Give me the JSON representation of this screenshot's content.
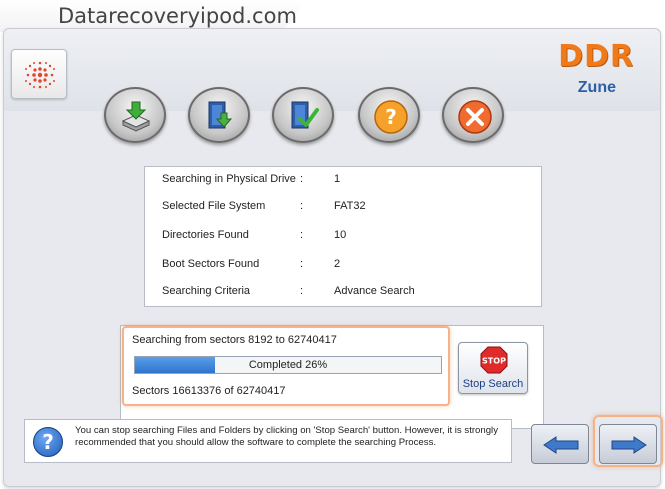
{
  "watermark": {
    "site": "Datarecoveryipod.com"
  },
  "header": {
    "brand": "DDR",
    "product": "Zune",
    "toolbar": [
      {
        "name": "recover-drive",
        "icon": "drive-download-icon"
      },
      {
        "name": "save-data",
        "icon": "door-save-icon"
      },
      {
        "name": "check-data",
        "icon": "door-check-icon"
      },
      {
        "name": "help",
        "icon": "question-icon"
      },
      {
        "name": "exit",
        "icon": "close-icon"
      }
    ]
  },
  "info": {
    "rows": [
      {
        "label": "Searching in Physical Drive",
        "sep": ":",
        "value": "1"
      },
      {
        "label": "Selected File System",
        "sep": ":",
        "value": "FAT32"
      },
      {
        "label": "Directories Found",
        "sep": ":",
        "value": "10"
      },
      {
        "label": "Boot Sectors Found",
        "sep": ":",
        "value": "2"
      },
      {
        "label": "Searching Criteria",
        "sep": ":",
        "value": "Advance Search"
      }
    ]
  },
  "progress": {
    "range_label": "Searching from sectors  8192 to 62740417",
    "completed_label": "Completed 26%",
    "percent": 26,
    "sectors_label": "Sectors  16613376 of 62740417",
    "stop_sign_text": "STOP",
    "stop_button_label": "Stop Search"
  },
  "help": {
    "text": "You can stop searching Files and Folders by clicking on 'Stop Search' button. However, it is strongly recommended that you should allow the software to complete the searching Process."
  },
  "nav": {
    "back_icon": "arrow-left-icon",
    "next_icon": "arrow-right-icon"
  },
  "colors": {
    "brand": "#f07a1a",
    "product": "#2c5fa5",
    "highlight": "#f3b48a",
    "progress": "#2e74cf"
  }
}
